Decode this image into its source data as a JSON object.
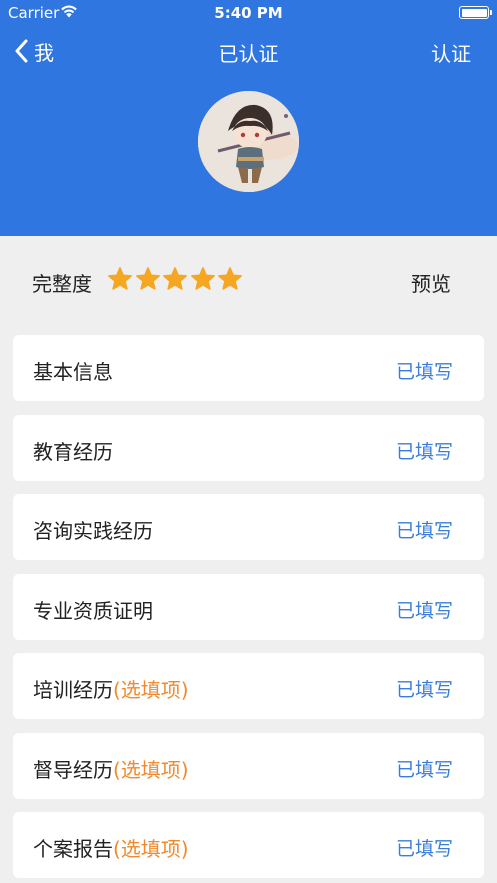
{
  "status_bar": {
    "carrier": "Carrier",
    "time": "5:40 PM"
  },
  "nav": {
    "back_label": "我",
    "title": "已认证",
    "right_action": "认证"
  },
  "completeness": {
    "label": "完整度",
    "rating": 5,
    "max_rating": 5,
    "preview_label": "预览",
    "star_color": "#f5a623"
  },
  "colors": {
    "header": "#2f76e0",
    "status_filled": "#3a7ed8",
    "optional": "#f08a2c"
  },
  "sections": [
    {
      "title": "基本信息",
      "optional": "",
      "status": "已填写"
    },
    {
      "title": "教育经历",
      "optional": "",
      "status": "已填写"
    },
    {
      "title": "咨询实践经历",
      "optional": "",
      "status": "已填写"
    },
    {
      "title": "专业资质证明",
      "optional": "",
      "status": "已填写"
    },
    {
      "title": "培训经历",
      "optional": "(选填项)",
      "status": "已填写"
    },
    {
      "title": "督导经历",
      "optional": "(选填项)",
      "status": "已填写"
    },
    {
      "title": "个案报告",
      "optional": "(选填项)",
      "status": "已填写"
    }
  ]
}
